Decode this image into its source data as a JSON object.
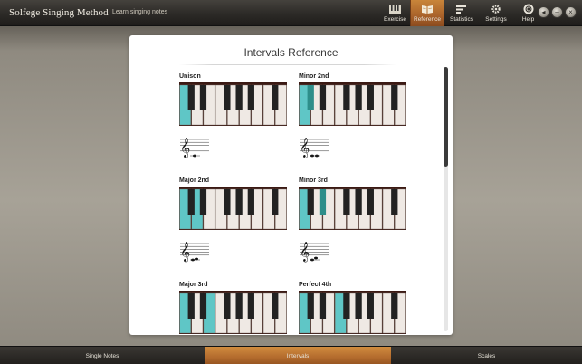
{
  "app": {
    "title": "Solfege Singing Method",
    "subtitle": "Learn singing notes"
  },
  "nav": {
    "items": [
      {
        "label": "Exercise",
        "icon": "exercise-icon",
        "active": false
      },
      {
        "label": "Reference",
        "icon": "reference-icon",
        "active": true
      },
      {
        "label": "Statistics",
        "icon": "statistics-icon",
        "active": false
      },
      {
        "label": "Settings",
        "icon": "settings-icon",
        "active": false
      },
      {
        "label": "Help",
        "icon": "help-icon",
        "active": false
      }
    ]
  },
  "window_controls": [
    {
      "name": "back-button",
      "glyph": "◂"
    },
    {
      "name": "minimize-button",
      "glyph": "–"
    },
    {
      "name": "close-button",
      "glyph": "×"
    }
  ],
  "panel": {
    "title": "Intervals Reference"
  },
  "intervals": [
    {
      "name": "Unison",
      "highlight": [
        0
      ],
      "black_highlight": []
    },
    {
      "name": "Minor 2nd",
      "highlight": [
        0
      ],
      "black_highlight": [
        0
      ]
    },
    {
      "name": "Major 2nd",
      "highlight": [
        0,
        1
      ],
      "black_highlight": []
    },
    {
      "name": "Minor 3rd",
      "highlight": [
        0
      ],
      "black_highlight": [
        1
      ]
    },
    {
      "name": "Major 3rd",
      "highlight": [
        0,
        2
      ],
      "black_highlight": []
    },
    {
      "name": "Perfect 4th",
      "highlight": [
        0,
        3
      ],
      "black_highlight": []
    }
  ],
  "colors": {
    "highlight": "#5fc6c6",
    "black_highlight": "#2e8e8a",
    "active_tab": "#b26a2d"
  },
  "bottom_tabs": [
    {
      "label": "Single Notes",
      "active": false
    },
    {
      "label": "Intervals",
      "active": true
    },
    {
      "label": "Scales",
      "active": false
    }
  ]
}
